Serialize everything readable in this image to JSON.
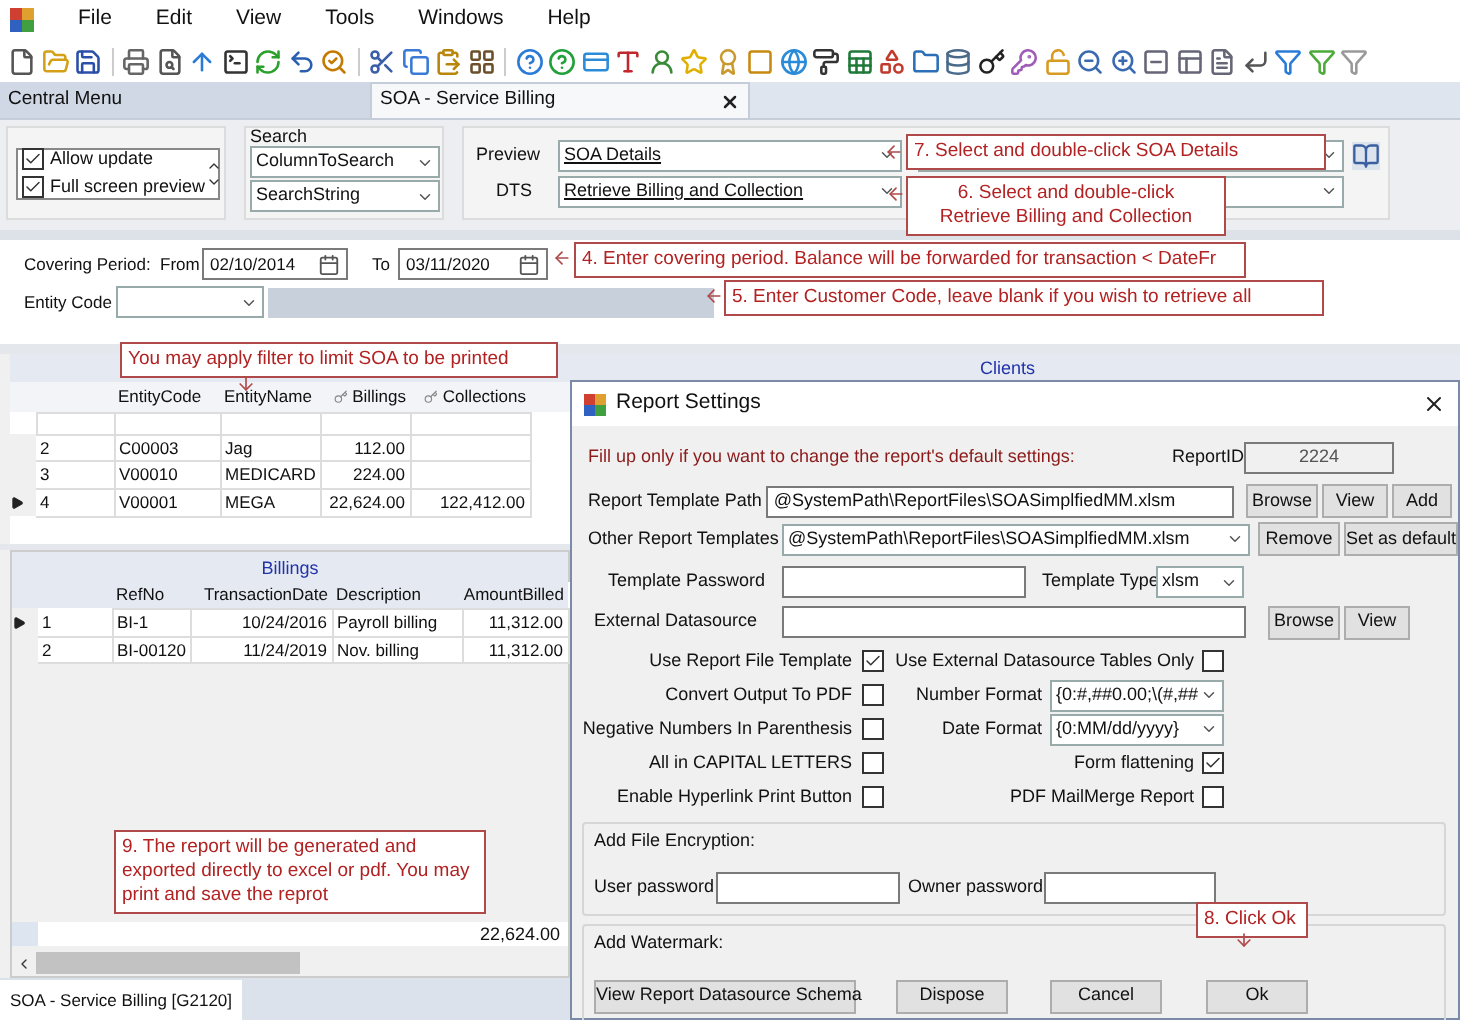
{
  "menu": [
    "File",
    "Edit",
    "View",
    "Tools",
    "Windows",
    "Help"
  ],
  "tabs": [
    {
      "label": "Central Menu",
      "selected": false
    },
    {
      "label": "SOA - Service Billing",
      "selected": true
    }
  ],
  "options": [
    {
      "label": "Allow update",
      "checked": true
    },
    {
      "label": "Full screen preview",
      "checked": true
    }
  ],
  "search": {
    "title": "Search",
    "column": "ColumnToSearch",
    "string": "SearchString"
  },
  "preview": {
    "label": "Preview",
    "value": "SOA Details"
  },
  "dts": {
    "label": "DTS",
    "value": "Retrieve Billing and Collection"
  },
  "period": {
    "label": "Covering Period:",
    "from_label": "From",
    "from": "02/10/2014",
    "to_label": "To",
    "to": "03/11/2020"
  },
  "entity": {
    "label": "Entity Code"
  },
  "clients": {
    "title": "Clients",
    "columns": [
      "EntityCode",
      "EntityName",
      "Billings",
      "Collections"
    ],
    "rows": [
      {
        "no": "2",
        "code": "C00003",
        "name": "Jag",
        "billings": "112.00",
        "selected": false
      },
      {
        "no": "3",
        "code": "V00010",
        "name": "MEDICARD",
        "billings": "224.00",
        "selected": false
      },
      {
        "no": "4",
        "code": "V00001",
        "name": "MEGA",
        "billings": "22,624.00",
        "collections": "122,412.00",
        "selected": true
      }
    ]
  },
  "billings": {
    "title": "Billings",
    "columns": [
      "RefNo",
      "TransactionDate",
      "Description",
      "AmountBilled"
    ],
    "rows": [
      {
        "no": "1",
        "ref": "BI-1",
        "date": "10/24/2016",
        "description": "Payroll billing",
        "amount": "11,312.00",
        "selected": true
      },
      {
        "no": "2",
        "ref": "BI-00120",
        "date": "11/24/2019",
        "description": "Nov. billing",
        "amount": "11,312.00",
        "selected": false
      }
    ],
    "total": "22,624.00"
  },
  "status_tab": "SOA - Service Billing [G2120]",
  "dialog": {
    "title": "Report Settings",
    "note": "Fill up only if you want to change the report's default settings:",
    "report_id_label": "ReportID",
    "report_id": "2224",
    "template_path_label": "Report Template Path",
    "template_path": "@SystemPath\\ReportFiles\\SOASimplfiedMM.xlsm",
    "other_templates_label": "Other Report Templates",
    "other_templates": "@SystemPath\\ReportFiles\\SOASimplfiedMM.xlsm",
    "template_password_label": "Template Password",
    "template_type_label": "Template Type",
    "template_type": "xlsm",
    "external_label": "External Datasource",
    "path_buttons": [
      "Browse",
      "View",
      "Add"
    ],
    "template_buttons": [
      "Remove",
      "Set as default"
    ],
    "external_buttons": [
      "Browse",
      "View"
    ],
    "left_checks": [
      {
        "label": "Use Report File Template",
        "checked": true
      },
      {
        "label": "Convert Output To PDF",
        "checked": false
      },
      {
        "label": "Negative Numbers In Parenthesis",
        "checked": false
      },
      {
        "label": "All in CAPITAL LETTERS",
        "checked": false
      },
      {
        "label": "Enable Hyperlink Print Button",
        "checked": false
      }
    ],
    "right_items": [
      {
        "kind": "checkbox",
        "label": "Use External Datasource Tables Only",
        "checked": false
      },
      {
        "kind": "combo",
        "label": "Number Format",
        "value": "{0:#,##0.00;\\(#,##"
      },
      {
        "kind": "combo",
        "label": "Date Format",
        "value": "{0:MM/dd/yyyy}"
      },
      {
        "kind": "checkbox",
        "label": "Form flattening",
        "checked": true
      },
      {
        "kind": "checkbox",
        "label": "PDF MailMerge Report",
        "checked": false
      }
    ],
    "encryption": {
      "title": "Add File Encryption:",
      "user_label": "User password",
      "owner_label": "Owner password"
    },
    "watermark": {
      "title": "Add Watermark:"
    },
    "buttons": [
      "View Report Datasource Schema",
      "Dispose",
      "Cancel",
      "Ok"
    ]
  },
  "annotations": [
    {
      "text": "7. Select and double-click SOA Details"
    },
    {
      "lines": [
        "6. Select and double-click",
        "Retrieve Billing and Collection"
      ]
    },
    {
      "text": "4. Enter covering period. Balance will be forwarded for transaction <  DateFr"
    },
    {
      "text": "5. Enter Customer Code, leave blank if you wish to retrieve all"
    },
    {
      "text": "You may apply filter to limit SOA to be printed"
    },
    {
      "text": "9. The report will be generated and exported directly to excel or pdf. You may print and save the reprot"
    },
    {
      "text": "8. Click Ok"
    }
  ]
}
